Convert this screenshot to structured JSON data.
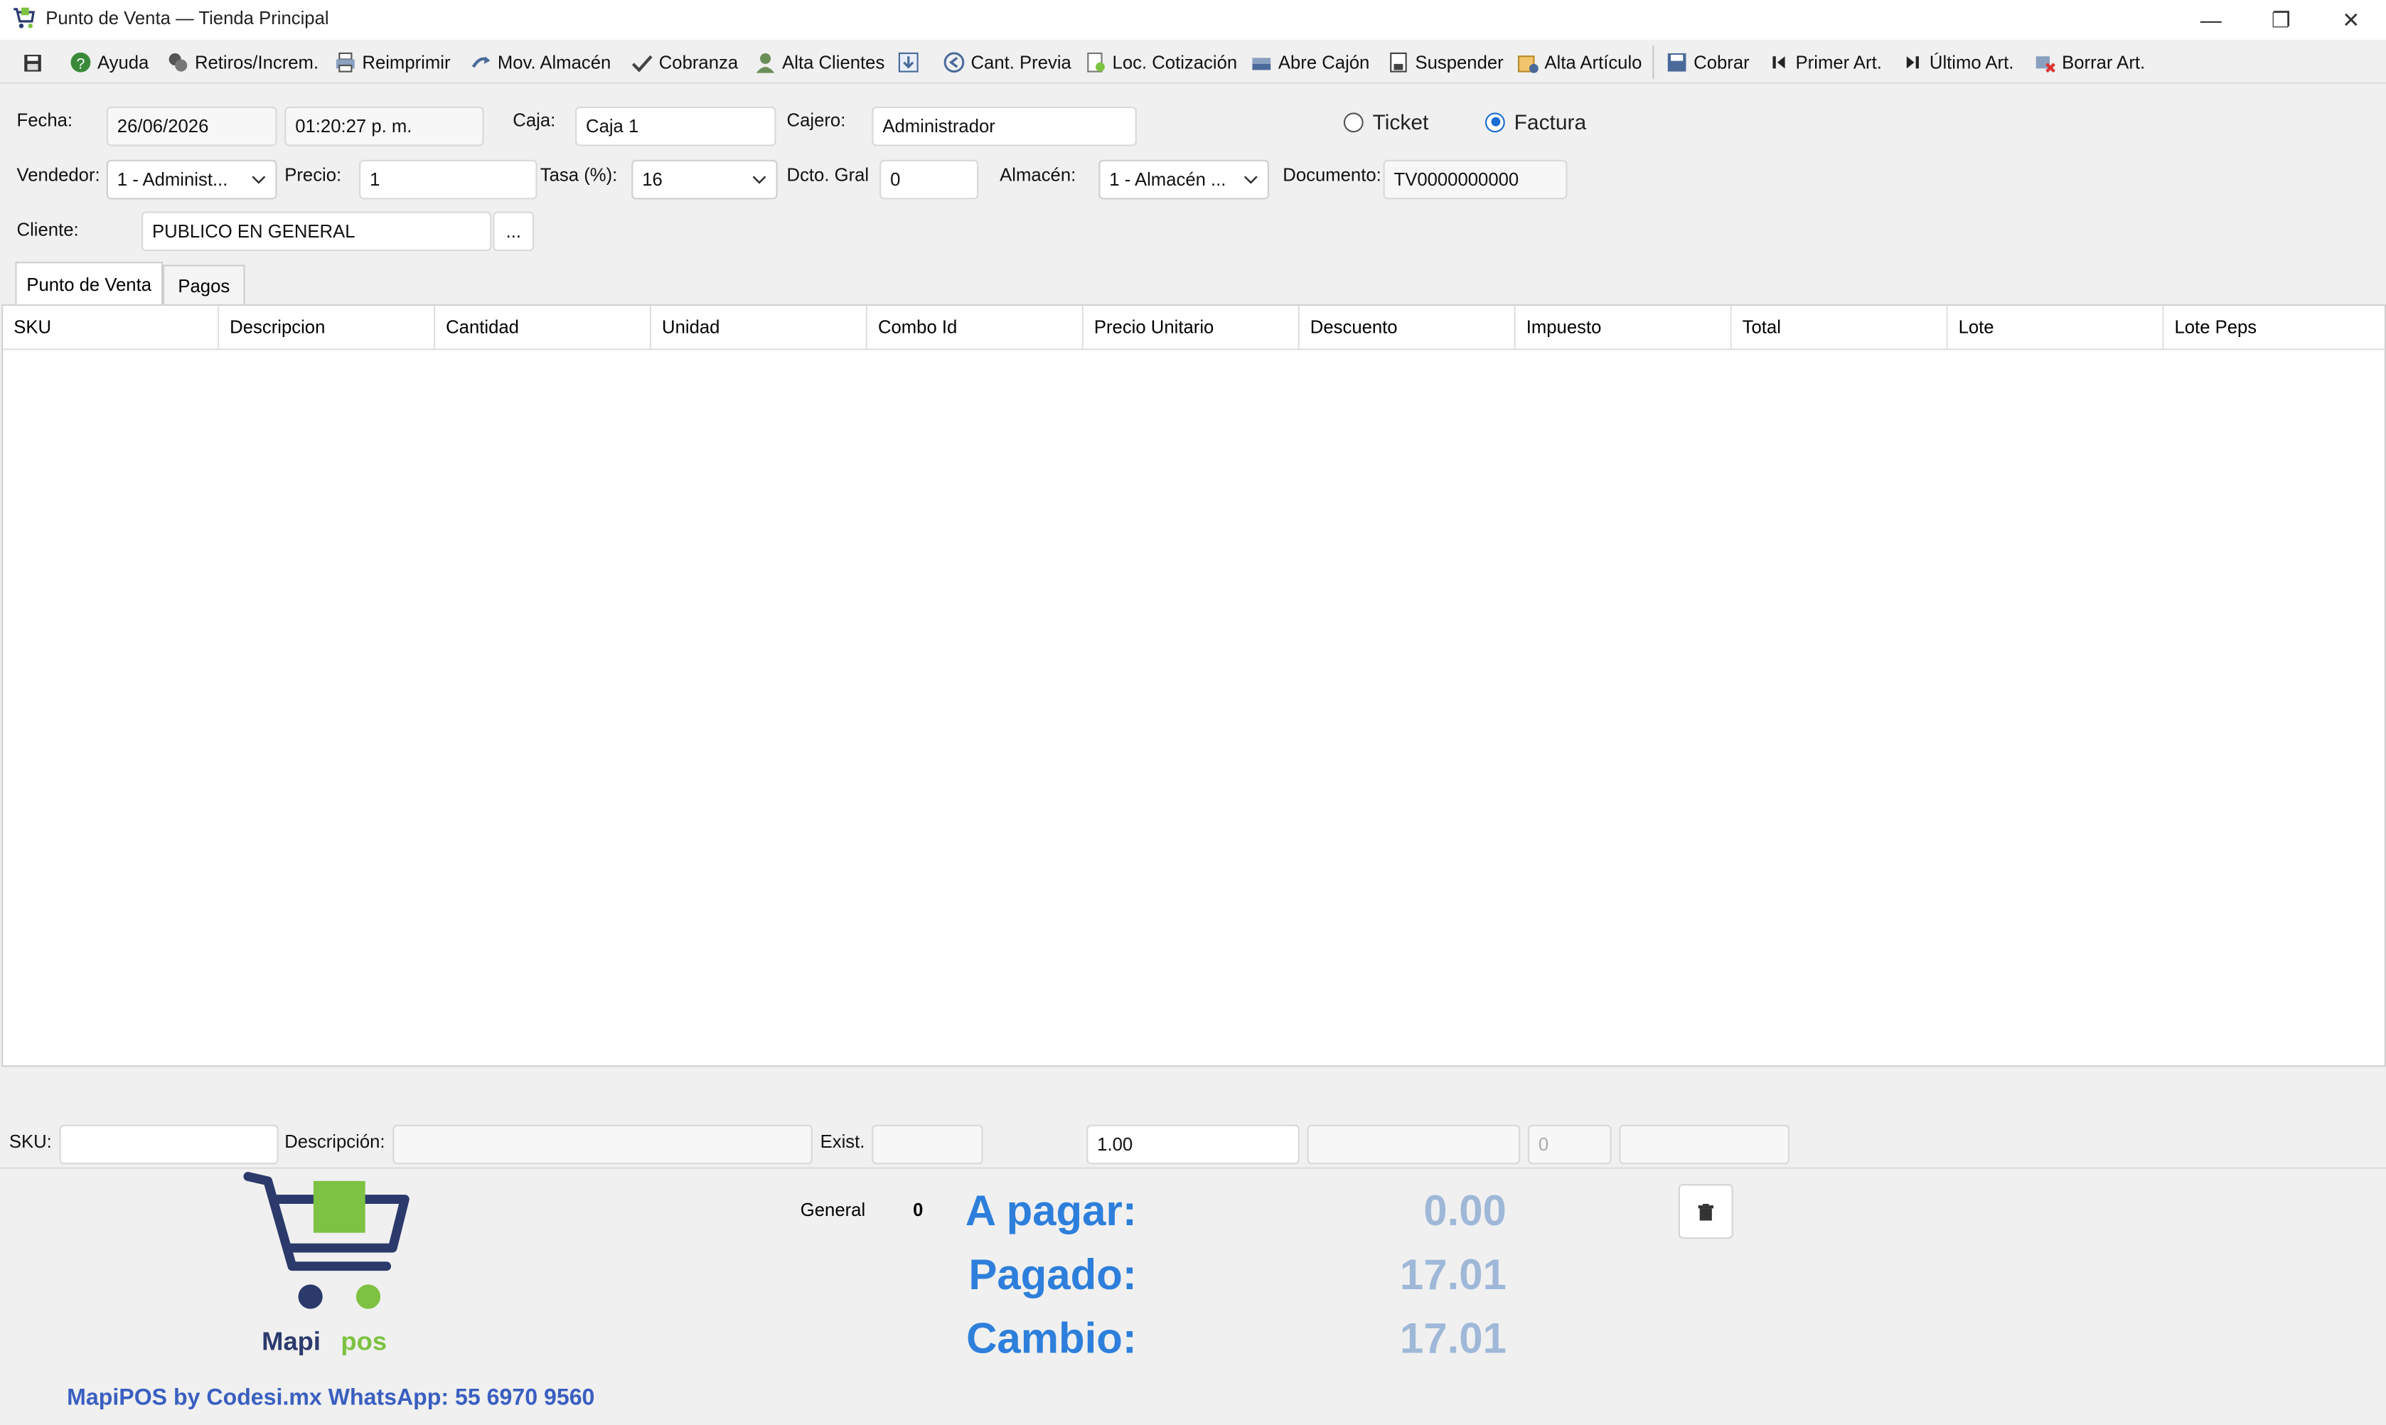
{
  "window": {
    "title": "Punto de Venta — Tienda Principal",
    "minimize_glyph": "—",
    "maximize_glyph": "❐",
    "close_glyph": "✕"
  },
  "toolbar": {
    "items": [
      {
        "label": "Ayuda",
        "icon": "help-icon"
      },
      {
        "label": "Retiros/Increm.",
        "icon": "coins-icon"
      },
      {
        "label": "Reimprimir",
        "icon": "printer-icon"
      },
      {
        "label": "Mov. Almacén",
        "icon": "transfer-icon"
      },
      {
        "label": "Cobranza",
        "icon": "collection-icon"
      },
      {
        "label": "Alta Clientes",
        "icon": "user-icon"
      },
      {
        "label": "",
        "icon": "download-icon"
      },
      {
        "label": "Cant. Previa",
        "icon": "back-arrow-icon"
      },
      {
        "label": "Loc. Cotización",
        "icon": "quote-icon"
      },
      {
        "label": "Abre Cajón",
        "icon": "cash-drawer-icon"
      },
      {
        "label": "Suspender",
        "icon": "suspend-icon"
      },
      {
        "label": "Alta Artículo",
        "icon": "add-item-icon"
      },
      {
        "label": "Cobrar",
        "icon": "save-icon"
      },
      {
        "label": "Primer Art.",
        "icon": "first-icon"
      },
      {
        "label": "Último Art.",
        "icon": "last-icon"
      },
      {
        "label": "Borrar Art.",
        "icon": "delete-item-icon"
      }
    ]
  },
  "form": {
    "fecha_label": "Fecha:",
    "fecha": "26/06/2026",
    "hora": "01:20:27 p. m.",
    "caja_label": "Caja:",
    "caja": "Caja 1",
    "cajero_label": "Cajero:",
    "cajero": "Administrador",
    "ticket_label": "Ticket",
    "factura_label": "Factura",
    "selected_doc": "Factura",
    "vendedor_label": "Vendedor:",
    "vendedor": "1 - Administ...",
    "precio_label": "Precio:",
    "precio": "1",
    "tasa_label": "Tasa (%):",
    "tasa": "16",
    "dcto_label": "Dcto. Gral",
    "dcto": "0",
    "almacen_label": "Almacén:",
    "almacen": "1 - Almacén ...",
    "documento_label": "Documento:",
    "documento": "TV0000000000",
    "cliente_label": "Cliente:",
    "cliente": "PUBLICO EN GENERAL",
    "cliente_btn": "..."
  },
  "tabs": [
    {
      "label": "Punto de Venta",
      "active": true
    },
    {
      "label": "Pagos",
      "active": false
    }
  ],
  "grid": {
    "columns": [
      "SKU",
      "Descripcion",
      "Cantidad",
      "Unidad",
      "Combo Id",
      "Precio Unitario",
      "Descuento",
      "Impuesto",
      "Total",
      "Lote",
      "Lote Peps"
    ],
    "rows": []
  },
  "entry": {
    "sku_label": "SKU:",
    "sku": "",
    "desc_label": "Descripción:",
    "desc": "",
    "exist_label": "Exist.",
    "exist": "",
    "cantidad": "1.00",
    "precio": "",
    "impuesto": "0",
    "total": ""
  },
  "totals": {
    "general_label": "General",
    "general_value": "0",
    "a_pagar_label": "A pagar:",
    "a_pagar": "0.00",
    "pagado_label": "Pagado:",
    "pagado": "17.01",
    "cambio_label": "Cambio:",
    "cambio": "17.01"
  },
  "brand": {
    "logo_text_1": "Mapi",
    "logo_text_2": "pos",
    "footer": "MapiPOS by Codesi.mx WhatsApp: 55 6970 9560",
    "primary_color": "#2d7fdb",
    "green_color": "#7dc242",
    "navy_color": "#2b3a6b"
  }
}
